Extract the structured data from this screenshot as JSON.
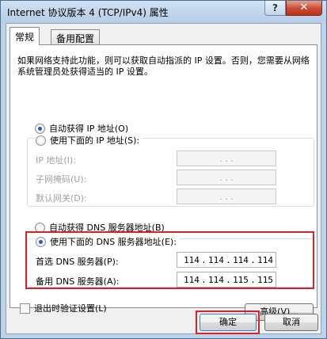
{
  "window": {
    "title": "Internet 协议版本 4 (TCP/IPv4) 属性",
    "help_label": "?",
    "close_label": "✕"
  },
  "tabs": [
    {
      "label": "常规",
      "active": true
    },
    {
      "label": "备用配置",
      "active": false
    }
  ],
  "description": "如果网络支持此功能，则可以获取自动指派的 IP 设置。否则，您需要从网络系统管理员处获得适当的 IP 设置。",
  "ip_section": {
    "auto_label": "自动获得 IP 地址(O)",
    "manual_label": "使用下面的 IP 地址(S):",
    "auto_selected": true,
    "fields": [
      {
        "label": "IP 地址(I):",
        "value": ". . ."
      },
      {
        "label": "子网掩码(U):",
        "value": ". . ."
      },
      {
        "label": "默认网关(D):",
        "value": ". . ."
      }
    ]
  },
  "dns_section": {
    "auto_label": "自动获得 DNS 服务器地址(B)",
    "manual_label": "使用下面的 DNS 服务器地址(E):",
    "manual_selected": true,
    "preferred": {
      "label": "首选 DNS 服务器(P):",
      "octets": [
        "114",
        "114",
        "114",
        "114"
      ]
    },
    "alternate": {
      "label": "备用 DNS 服务器(A):",
      "octets": [
        "114",
        "114",
        "115",
        "115"
      ]
    }
  },
  "validate_on_exit_label": "退出时验证设置(L)",
  "advanced_label": "高级(V)...",
  "ok_label": "确定",
  "cancel_label": "取消",
  "colors": {
    "highlight": "#d4232a",
    "title_gradient_top": "#cfe0f3",
    "close_button": "#c84a33"
  }
}
